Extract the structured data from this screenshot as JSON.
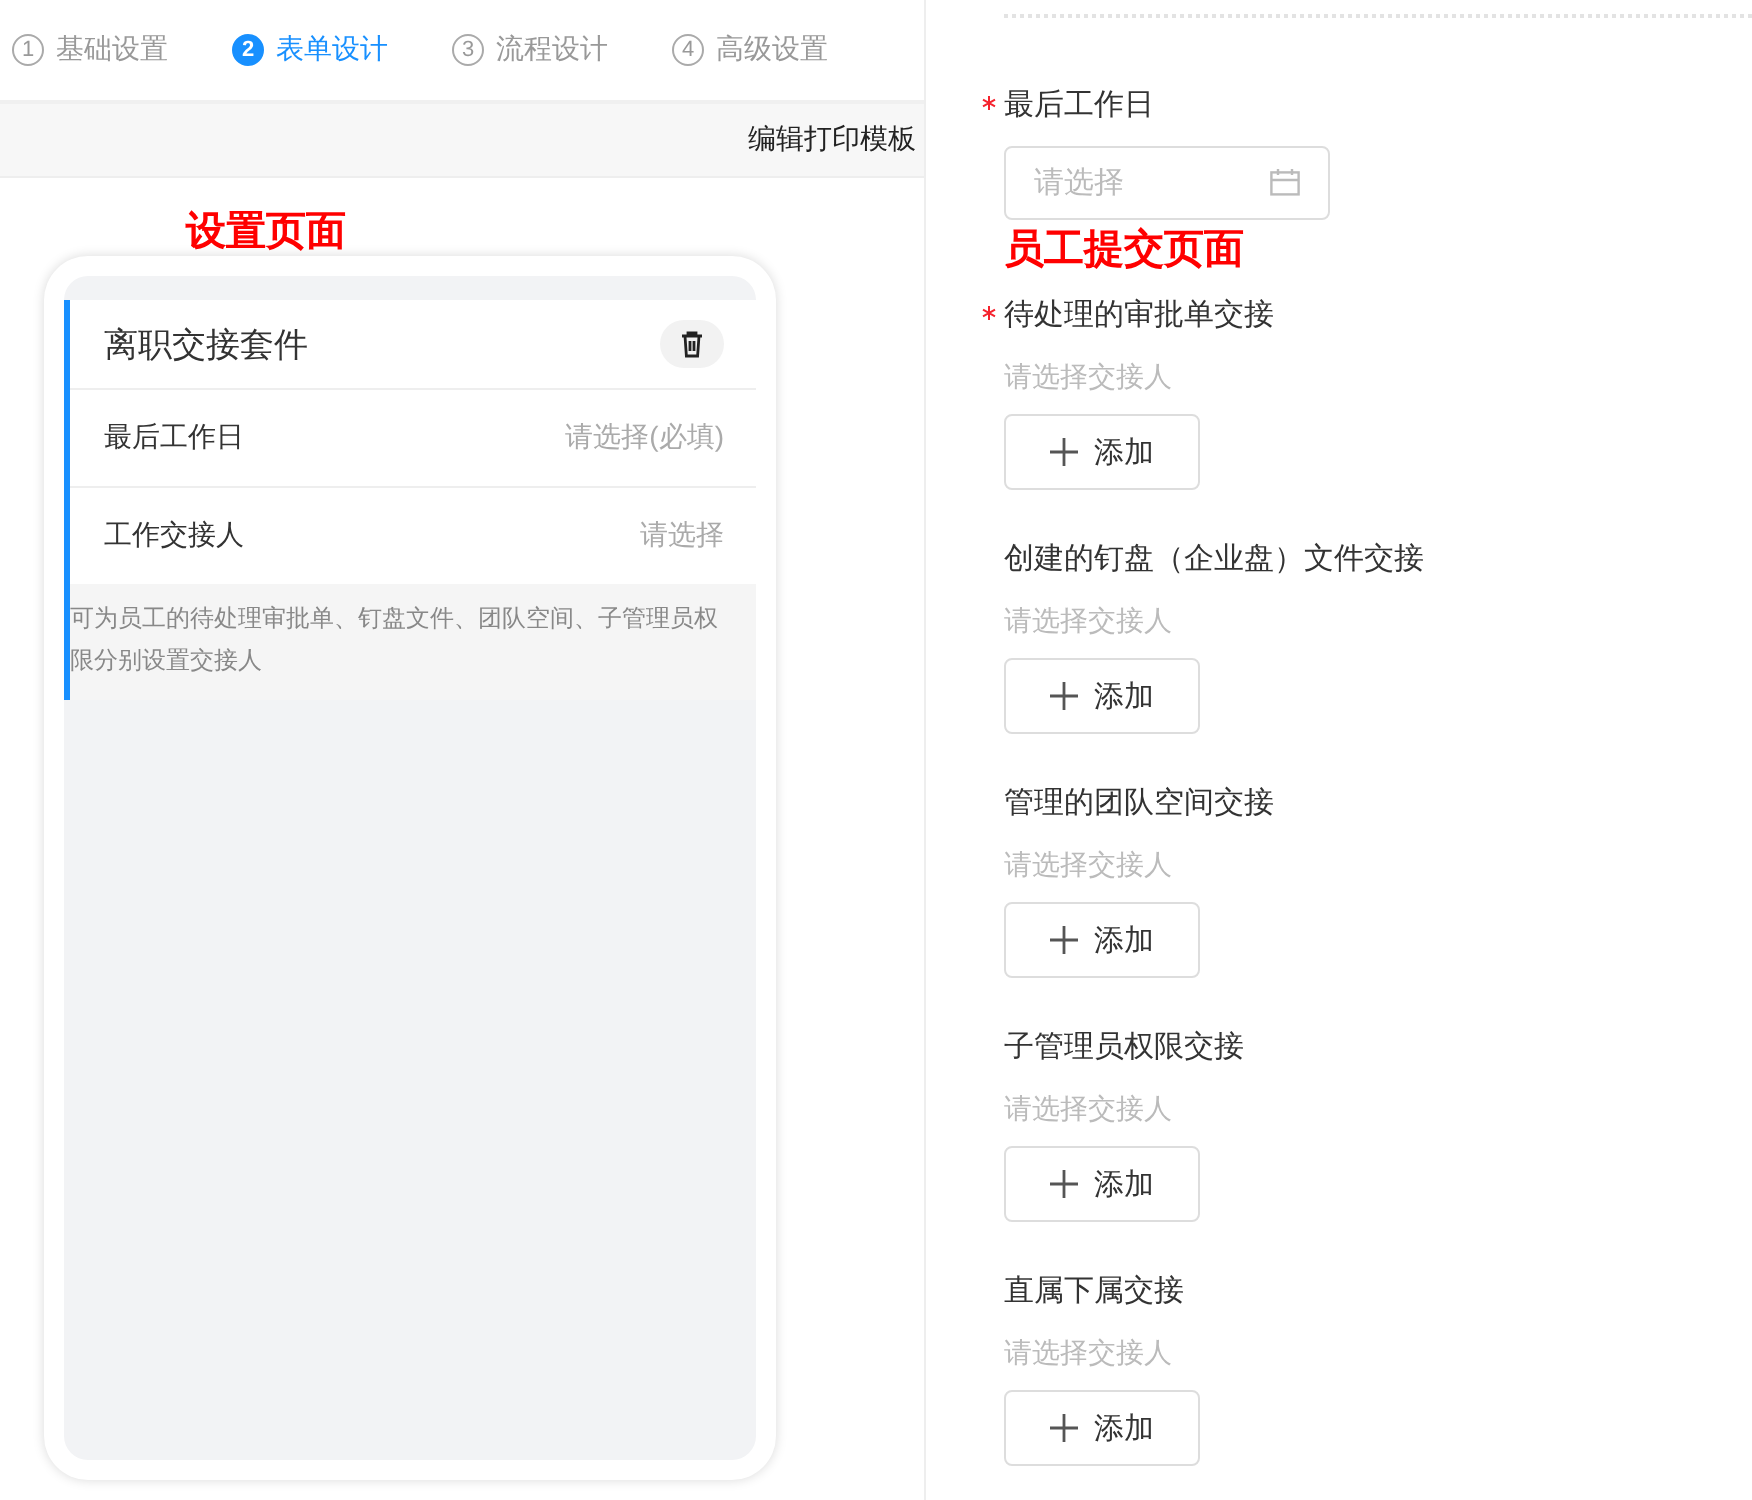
{
  "steps": [
    {
      "number": "1",
      "label": "基础设置",
      "selected": false
    },
    {
      "number": "2",
      "label": "表单设计",
      "selected": true
    },
    {
      "number": "3",
      "label": "流程设计",
      "selected": false
    },
    {
      "number": "4",
      "label": "高级设置",
      "selected": false
    }
  ],
  "toolbar": {
    "action": "编辑打印模板"
  },
  "settings_annotation": "设置页面",
  "component": {
    "title": "离职交接套件",
    "rows": [
      {
        "label": "最后工作日",
        "value": "请选择(必填)"
      },
      {
        "label": "工作交接人",
        "value": "请选择"
      }
    ],
    "hint": "可为员工的待处理审批单、钉盘文件、团队空间、子管理员权限分别设置交接人"
  },
  "form": [
    {
      "kind": "date",
      "label": "最后工作日",
      "required": true,
      "placeholder": "请选择"
    },
    {
      "kind": "annotation",
      "text": "员工提交页面"
    },
    {
      "kind": "picker",
      "label": "待处理的审批单交接",
      "required": true,
      "hint": "请选择交接人",
      "button": "添加"
    },
    {
      "kind": "picker",
      "label": "创建的钉盘（企业盘）文件交接",
      "required": false,
      "hint": "请选择交接人",
      "button": "添加"
    },
    {
      "kind": "picker",
      "label": "管理的团队空间交接",
      "required": false,
      "hint": "请选择交接人",
      "button": "添加"
    },
    {
      "kind": "picker",
      "label": "子管理员权限交接",
      "required": false,
      "hint": "请选择交接人",
      "button": "添加"
    },
    {
      "kind": "picker",
      "label": "直属下属交接",
      "required": false,
      "hint": "请选择交接人",
      "button": "添加"
    }
  ]
}
